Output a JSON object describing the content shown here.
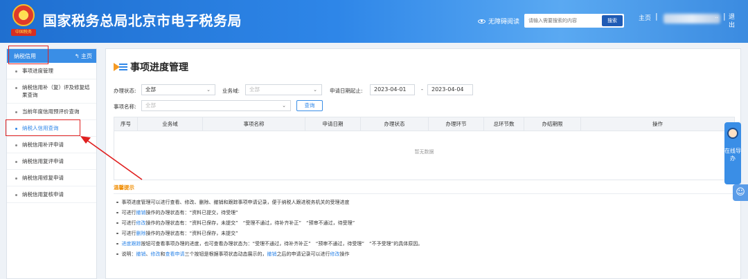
{
  "header": {
    "site_title": "国家税务总局北京市电子税务局",
    "emblem_text": "中国税务",
    "accessibility": "无障碍阅读",
    "search_placeholder": "请输入需要搜索的内容",
    "search_button": "搜索",
    "home": "主页",
    "user_ellipsis": "..",
    "logout": "退出"
  },
  "sidebar": {
    "header_title": "纳税信用",
    "header_home": "主页",
    "items": [
      {
        "label": "事项进度管理"
      },
      {
        "label": "纳税信用补（复）评及修复结果查询"
      },
      {
        "label": "当前年度信用预评价查询"
      },
      {
        "label": "纳税人信用查询"
      },
      {
        "label": "纳税信用补评申请"
      },
      {
        "label": "纳税信用复评申请"
      },
      {
        "label": "纳税信用修复申请"
      },
      {
        "label": "纳税信用复核申请"
      }
    ]
  },
  "main": {
    "page_title": "事项进度管理",
    "filters": {
      "status_label": "办理状态:",
      "status_value": "全部",
      "domain_label": "业务域:",
      "domain_value": "全部",
      "date_label": "申请日期起止:",
      "date_start": "2023-04-01",
      "date_sep": "-",
      "date_end": "2023-04-04",
      "item_label": "事项名称:",
      "item_value": "全部",
      "query_button": "查询"
    },
    "table": {
      "headers": [
        "序号",
        "业务域",
        "事项名称",
        "申请日期",
        "办理状态",
        "办理环节",
        "总环节数",
        "办结期限",
        "操作"
      ],
      "empty_text": "暂无数据"
    },
    "tips": {
      "title": "温馨提示",
      "line1": "事项进度管理可以进行查看、修改、删除、撤销和跟踪事项申请记录，便于纳税人跟进税务机关的受理进度",
      "line2_a": "可进行",
      "line2_hl": "撤销",
      "line2_b": "操作的办理状态有：“资料已提交，待受理”",
      "line3_a": "可进行",
      "line3_hl": "修改",
      "line3_b": "操作的办理状态有：“资料已保存，未提交”　“受理不通过，待补齐补正”　“预审不通过，待受理”",
      "line4_a": "可进行",
      "line4_hl": "删除",
      "line4_b": "操作的办理状态有：“资料已保存，未提交”",
      "line5_hl": "进度跟踪",
      "line5_b": "按钮可查看事项办理的进度，也可查看办理状态为：“受理不通过，待补齐补正”　“预审不通过，待受理”　“不予受理”的具体原因。",
      "line6_a": "说明：",
      "line6_hl1": "撤销",
      "line6_b": "、",
      "line6_hl2": "修改",
      "line6_c": "和",
      "line6_hl3": "查看申请",
      "line6_d": "三个按钮是根据事项状态动态展示的，",
      "line6_hl4": "撤销",
      "line6_e": "之后的申请记录可以进行",
      "line6_hl5": "修改",
      "line6_f": "操作"
    }
  },
  "float": {
    "online_help": "在线导办"
  },
  "colors": {
    "header_blue": "#2e86e8",
    "sidebar_header": "#3a8ee6",
    "highlight_red": "#e02020",
    "tips_orange": "#f08c00",
    "link_blue": "#2e86e8"
  }
}
